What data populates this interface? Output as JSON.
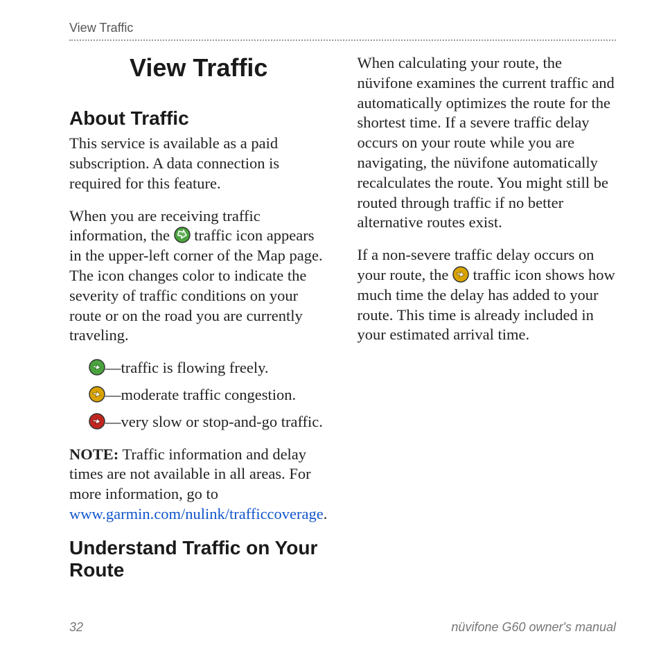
{
  "header": {
    "section_label": "View Traffic"
  },
  "icons": {
    "green": "#4aa33e",
    "yellow": "#d9a300",
    "red": "#c0261f",
    "arrow_stroke": "#ffffff",
    "border": "#333333"
  },
  "chapter": {
    "title": "View Traffic"
  },
  "about": {
    "heading": "About Traffic",
    "p1": "This service is available as a paid subscription. A data connection is required for this feature.",
    "p2a": "When you are receiving traffic information, the ",
    "p2b": " traffic icon appears in the upper-left corner of the Map page. The icon changes color to indicate the severity of traffic conditions on your route or on the road you are currently traveling.",
    "legend": {
      "green": "—traffic is flowing freely.",
      "yellow": "—moderate traffic congestion.",
      "red": "—very slow or stop-and-go traffic."
    },
    "note_label": "NOTE:",
    "note_body_a": " Traffic information and delay times are not available in all areas. For more information, ",
    "note_body_b": "go to ",
    "link_text": "www.garmin.com/nulink/trafficcoverage",
    "note_body_c": "."
  },
  "understand": {
    "heading": "Understand Traffic on Your Route",
    "p1": "When calculating your route, the nüvifone examines the current traffic and automatically optimizes the route for the shortest time. If a severe traffic delay occurs on your route while you are navigating, the nüvifone automatically recalculates the route. You might still be routed through traffic if no better alternative routes exist.",
    "p2a": "If a non-severe traffic delay occurs on your route, the ",
    "p2b": " traffic icon shows how much time the delay has added to your route. This time is already included in your estimated arrival time."
  },
  "footer": {
    "page": "32",
    "manual": "nüvifone G60 owner's manual"
  }
}
